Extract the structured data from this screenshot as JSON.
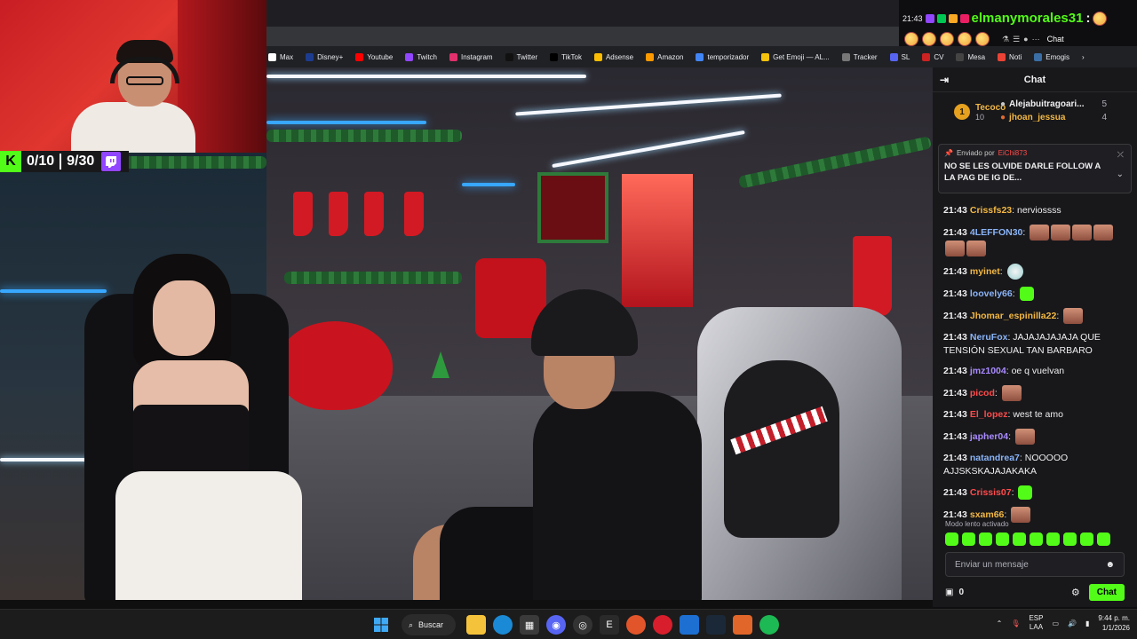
{
  "overlay": {
    "counter_left": "0/10",
    "counter_right": "9/30",
    "kick_letter": "K"
  },
  "bookmarks": [
    {
      "label": "Max",
      "color": "#ffffff"
    },
    {
      "label": "Disney+",
      "color": "#1d3c8f"
    },
    {
      "label": "Youtube",
      "color": "#ff0000"
    },
    {
      "label": "Twitch",
      "color": "#9146ff"
    },
    {
      "label": "Instagram",
      "color": "#e1306c"
    },
    {
      "label": "Twitter",
      "color": "#111111"
    },
    {
      "label": "TikTok",
      "color": "#000000"
    },
    {
      "label": "Adsense",
      "color": "#fbbc04"
    },
    {
      "label": "Amazon",
      "color": "#ff9900"
    },
    {
      "label": "temporizador",
      "color": "#4285f4"
    },
    {
      "label": "Get Emoji — AL...",
      "color": "#f4c20d"
    },
    {
      "label": "Tracker",
      "color": "#777777"
    },
    {
      "label": "SL",
      "color": "#5865f2"
    },
    {
      "label": "CV",
      "color": "#cc2222"
    },
    {
      "label": "Mesa",
      "color": "#444444"
    },
    {
      "label": "Noti",
      "color": "#ea4335"
    },
    {
      "label": "Emogis",
      "color": "#3a6ea5"
    }
  ],
  "top_chat": {
    "time": "21:43",
    "username": "elmanymorales31",
    "colon": ":",
    "chat_label": "Chat"
  },
  "chat": {
    "header": "Chat",
    "leaderboard": {
      "rank": "1",
      "first_name": "Tecoco",
      "first_points": "10",
      "others": [
        {
          "name": "Alejabuitragoari...",
          "points": "5"
        },
        {
          "name": "jhoan_jessua",
          "points": "4"
        }
      ]
    },
    "pinned": {
      "sent_by_label": "Enviado por",
      "sender": "EiChi873",
      "message": "NO SE LES OLVIDE DARLE FOLLOW A LA PAG DE IG DE..."
    },
    "messages": [
      {
        "time": "21:43",
        "user": "Crissfs23",
        "color": "#f3b843",
        "text": "nerviossss",
        "emote": ""
      },
      {
        "time": "21:43",
        "user": "4LEFFON30",
        "color": "#8ab4f8",
        "text": "",
        "emote": "faces"
      },
      {
        "time": "21:43",
        "user": "myinet",
        "color": "#f3b843",
        "text": "",
        "emote": "round"
      },
      {
        "time": "21:43",
        "user": "loovely66",
        "color": "#8ab4f8",
        "text": "",
        "emote": "green"
      },
      {
        "time": "21:43",
        "user": "Jhomar_espinilla22",
        "color": "#f3b843",
        "text": "",
        "emote": "face"
      },
      {
        "time": "21:43",
        "user": "NeruFox",
        "color": "#8ab4f8",
        "text": "JAJAJAJAJAJA QUE TENSIÓN SEXUAL TAN BARBARO",
        "emote": ""
      },
      {
        "time": "21:43",
        "user": "jmz1004",
        "color": "#a98bff",
        "text": "oe q vuelvan",
        "emote": ""
      },
      {
        "time": "21:43",
        "user": "picod",
        "color": "#ff4b4b",
        "text": "",
        "emote": "face"
      },
      {
        "time": "21:43",
        "user": "El_lopez",
        "color": "#ff4b4b",
        "text": "west te amo",
        "emote": ""
      },
      {
        "time": "21:43",
        "user": "japher04",
        "color": "#a98bff",
        "text": "",
        "emote": "face"
      },
      {
        "time": "21:43",
        "user": "natandrea7",
        "color": "#8ab4f8",
        "text": "NOOOOO AJJSKSKAJAJAKAKA",
        "emote": ""
      },
      {
        "time": "21:43",
        "user": "Crissis07",
        "color": "#ff4b4b",
        "text": "",
        "emote": "green"
      },
      {
        "time": "21:43",
        "user": "sxam66",
        "color": "#f3b843",
        "text": "",
        "emote": "face"
      }
    ],
    "slow_mode": "Modo lento activado",
    "input_placeholder": "Enviar un mensaje",
    "points": "0",
    "send_label": "Chat"
  },
  "taskbar": {
    "search_label": "Buscar",
    "lang_top": "ESP",
    "lang_bottom": "LAA",
    "time": "9:44 p. m.",
    "date": "1/1/2026"
  }
}
